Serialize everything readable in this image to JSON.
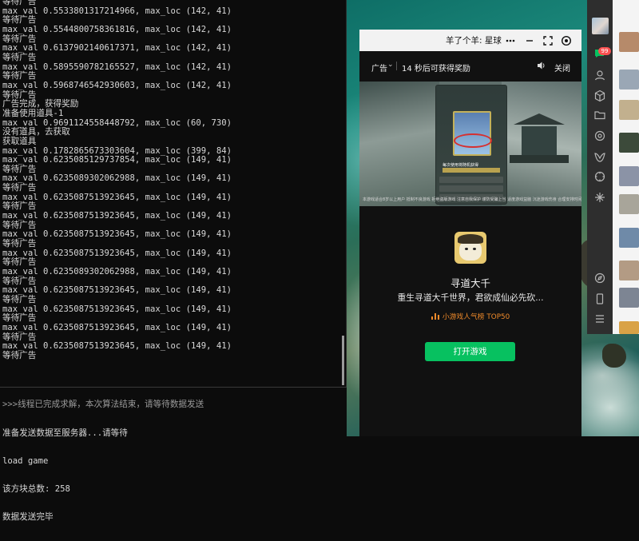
{
  "terminal": {
    "lines": [
      "等待广告",
      "max_val 0.5533801317214966, max_loc (142, 41)",
      "等待广告",
      "max_val 0.5544800758361816, max_loc (142, 41)",
      "等待广告",
      "max_val 0.6137902140617371, max_loc (142, 41)",
      "等待广告",
      "max_val 0.5895590782165527, max_loc (142, 41)",
      "等待广告",
      "max_val 0.5968746542930603, max_loc (142, 41)",
      "等待广告",
      "广告完成，获得奖励",
      "准备使用道具-1",
      "max_val 0.9691124558448792, max_loc (60, 730)",
      "没有道具，去获取",
      "获取道具",
      "max_val 0.1782865673303604, max_loc (399, 84)",
      "max_val 0.6235085129737854, max_loc (149, 41)",
      "等待广告",
      "max_val 0.6235089302062988, max_loc (149, 41)",
      "等待广告",
      "max_val 0.6235087513923645, max_loc (149, 41)",
      "等待广告",
      "max_val 0.6235087513923645, max_loc (149, 41)",
      "等待广告",
      "max_val 0.6235087513923645, max_loc (149, 41)",
      "等待广告",
      "max_val 0.6235087513923645, max_loc (149, 41)",
      "等待广告",
      "max_val 0.6235089302062988, max_loc (149, 41)",
      "等待广告",
      "max_val 0.6235087513923645, max_loc (149, 41)",
      "等待广告",
      "max_val 0.6235087513923645, max_loc (149, 41)",
      "等待广告",
      "max_val 0.6235087513923645, max_loc (149, 41)",
      "等待广告",
      "max_val 0.6235087513923645, max_loc (149, 41)",
      "等待广告"
    ],
    "bottom_lines": [
      ">>>线程已完成求解，本次算法结束，请等待数据发送",
      "准备发送数据至服务器...请等待",
      "load game",
      "该方块总数: 258",
      "数据发送完毕"
    ]
  },
  "mini_window": {
    "title": "羊了个羊: 星球",
    "ad_label": "广告",
    "ad_countdown": "14 秒后可获得奖励",
    "ad_close": "关闭",
    "banner_caption": "本游戏适合8岁以上用户 抵制不良游戏 拒绝盗版游戏 注意自我保护 谨防受骗上当 适度游戏益脑 沉迷游戏伤身 合理安排时间 享受健康生活",
    "banner_hint": "每次使用将随机获得",
    "game_name": "寻道大千",
    "game_desc": "重生寻道大千世界，君欲成仙必先砍...",
    "rank": "小游戏人气榜 TOP50",
    "open_button": "打开游戏"
  },
  "wechat": {
    "badge": "99",
    "sidebar_icons": [
      "chat-icon",
      "contacts-icon",
      "favorites-cube-icon",
      "folder-icon",
      "moments-icon",
      "channels-icon",
      "mini-program-icon",
      "search-spark-icon",
      "compass-icon",
      "phone-icon",
      "menu-icon"
    ]
  },
  "colors": {
    "accent_green": "#07c160",
    "rank_orange": "#f08a2a",
    "badge_red": "#fa5151"
  }
}
